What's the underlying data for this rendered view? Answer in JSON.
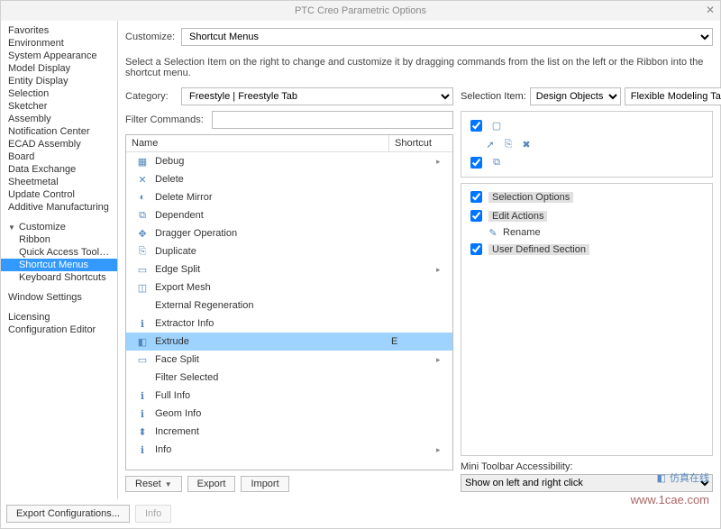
{
  "window_title": "PTC Creo Parametric Options",
  "sidebar": {
    "items": [
      "Favorites",
      "Environment",
      "System Appearance",
      "Model Display",
      "Entity Display",
      "Selection",
      "Sketcher",
      "Assembly",
      "Notification Center",
      "ECAD Assembly",
      "Board",
      "Data Exchange",
      "Sheetmetal",
      "Update Control",
      "Additive Manufacturing"
    ],
    "customize_header": "Customize",
    "customize_items": [
      "Ribbon",
      "Quick Access Toolbar",
      "Shortcut Menus",
      "Keyboard Shortcuts"
    ],
    "customize_selected": 2,
    "window_settings": "Window Settings",
    "licensing": "Licensing",
    "config_editor": "Configuration Editor"
  },
  "customize_label": "Customize:",
  "customize_value": "Shortcut Menus",
  "help_text": "Select a Selection Item on the right to change and customize it by dragging commands from the list on the left or the Ribbon into the shortcut menu.",
  "category_label": "Category:",
  "category_value": "Freestyle | Freestyle Tab",
  "filter_label": "Filter Commands:",
  "filter_value": "",
  "columns": {
    "name": "Name",
    "shortcut": "Shortcut"
  },
  "commands": [
    {
      "name": "Debug",
      "sc": "",
      "has_sub": true,
      "ic": "▦"
    },
    {
      "name": "Delete",
      "sc": "",
      "has_sub": false,
      "ic": "✕"
    },
    {
      "name": "Delete Mirror",
      "sc": "",
      "has_sub": false,
      "ic": "◐"
    },
    {
      "name": "Dependent",
      "sc": "",
      "has_sub": false,
      "ic": "⧉"
    },
    {
      "name": "Dragger Operation",
      "sc": "",
      "has_sub": false,
      "ic": "✥"
    },
    {
      "name": "Duplicate",
      "sc": "",
      "has_sub": false,
      "ic": "⎘"
    },
    {
      "name": "Edge Split",
      "sc": "",
      "has_sub": true,
      "ic": "▭"
    },
    {
      "name": "Export Mesh",
      "sc": "",
      "has_sub": false,
      "ic": "◫"
    },
    {
      "name": "External Regeneration",
      "sc": "",
      "has_sub": false,
      "ic": ""
    },
    {
      "name": "Extractor Info",
      "sc": "",
      "has_sub": false,
      "ic": "ℹ"
    },
    {
      "name": "Extrude",
      "sc": "E",
      "has_sub": false,
      "ic": "◧",
      "sel": true
    },
    {
      "name": "Face Split",
      "sc": "",
      "has_sub": true,
      "ic": "▭"
    },
    {
      "name": "Filter Selected",
      "sc": "",
      "has_sub": false,
      "ic": ""
    },
    {
      "name": "Full Info",
      "sc": "",
      "has_sub": false,
      "ic": "ℹ"
    },
    {
      "name": "Geom Info",
      "sc": "",
      "has_sub": false,
      "ic": "ℹ"
    },
    {
      "name": "Increment",
      "sc": "",
      "has_sub": false,
      "ic": "⬍"
    },
    {
      "name": "Info",
      "sc": "",
      "has_sub": true,
      "ic": "ℹ"
    }
  ],
  "sel_item_label": "Selection Item:",
  "sel_item_value": "Design Objects",
  "sel_tab_value": "Flexible Modeling Tab",
  "tree": {
    "sections": [
      {
        "label": "Selection Options",
        "checked": true
      },
      {
        "label": "Edit Actions",
        "checked": true,
        "children": [
          {
            "label": "Rename",
            "ic": "✎"
          }
        ]
      },
      {
        "label": "User Defined Section",
        "checked": true
      }
    ]
  },
  "mini_label": "Mini Toolbar Accessibility:",
  "mini_value": "Show on left and right click",
  "buttons": {
    "reset": "Reset",
    "export": "Export",
    "import": "Import"
  },
  "footer": {
    "export_cfg": "Export Configurations...",
    "info": "Info"
  },
  "watermark_cn": "仿真在线",
  "watermark_url": "www.1cae.com"
}
